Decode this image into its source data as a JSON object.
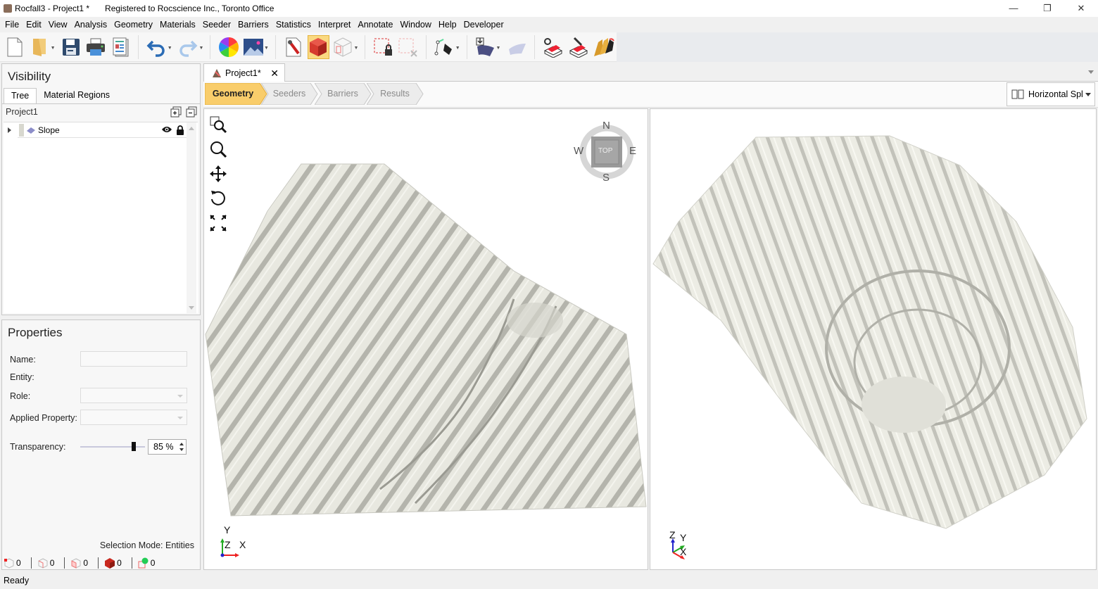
{
  "window": {
    "title": "Rocfall3 - Project1 *",
    "registration": "Registered to Rocscience Inc., Toronto Office",
    "controls": [
      "minimize",
      "restore",
      "close"
    ]
  },
  "menu": [
    "File",
    "Edit",
    "View",
    "Analysis",
    "Geometry",
    "Materials",
    "Seeder",
    "Barriers",
    "Statistics",
    "Interpret",
    "Annotate",
    "Window",
    "Help",
    "Developer"
  ],
  "toolbar": {
    "buttons": [
      {
        "name": "new-file-icon"
      },
      {
        "name": "open-folder-icon",
        "dropdown": true
      },
      {
        "name": "save-icon"
      },
      {
        "name": "print-icon"
      },
      {
        "name": "report-icon"
      },
      {
        "name": "undo-icon",
        "dropdown": true
      },
      {
        "name": "redo-icon",
        "dropdown": true
      },
      {
        "name": "color-wheel-icon"
      },
      {
        "name": "image-icon",
        "dropdown": true
      },
      {
        "name": "settings-wrench-icon"
      },
      {
        "name": "solid-view-icon",
        "active": true
      },
      {
        "name": "wireframe-view-icon",
        "dropdown": true
      },
      {
        "name": "lock-selection-icon"
      },
      {
        "name": "clear-selection-icon"
      },
      {
        "name": "draw-polyline-icon",
        "dropdown": true
      },
      {
        "name": "import-surface-icon",
        "dropdown": true
      },
      {
        "name": "surface-icon"
      },
      {
        "name": "seeder-settings-icon"
      },
      {
        "name": "seeder-edit-icon"
      },
      {
        "name": "barrier-layers-icon"
      }
    ]
  },
  "visibility": {
    "title": "Visibility",
    "tabs": [
      "Tree",
      "Material Regions"
    ],
    "active_tab": "Tree",
    "project": "Project1",
    "tree": [
      {
        "label": "Slope",
        "visible": true,
        "locked": true
      }
    ]
  },
  "properties": {
    "title": "Properties",
    "name_label": "Name:",
    "name_value": "",
    "entity_label": "Entity:",
    "role_label": "Role:",
    "applied_label": "Applied Property:",
    "transparency_label": "Transparency:",
    "transparency_value": "85 %",
    "transparency_percent": 85,
    "selection_mode": "Selection Mode:  Entities",
    "counts": [
      "0",
      "0",
      "0",
      "0",
      "0"
    ]
  },
  "document": {
    "tab_label": "Project1*",
    "workflow": [
      "Geometry",
      "Seeders",
      "Barriers",
      "Results"
    ],
    "active_step": "Geometry",
    "layout_select": "Horizontal Spl"
  },
  "viewport_left": {
    "view_label": "TOP",
    "compass": {
      "n": "N",
      "s": "S",
      "e": "E",
      "w": "W"
    },
    "axes": {
      "y": "Y",
      "z": "Z",
      "x": "X"
    }
  },
  "viewport_right": {
    "axes": {
      "z": "Z",
      "y": "Y",
      "x": "X"
    }
  },
  "status": "Ready"
}
